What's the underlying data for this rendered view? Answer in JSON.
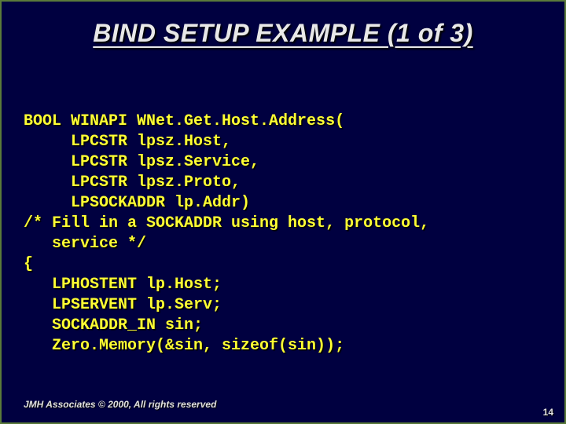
{
  "slide": {
    "title": "BIND SETUP EXAMPLE (1 of 3)",
    "footer": "JMH Associates © 2000, All rights reserved",
    "page_number": "14",
    "code": "BOOL WINAPI WNet.Get.Host.Address(\n     LPCSTR lpsz.Host,\n     LPCSTR lpsz.Service,\n     LPCSTR lpsz.Proto,\n     LPSOCKADDR lp.Addr)\n/* Fill in a SOCKADDR using host, protocol,\n   service */\n{\n   LPHOSTENT lp.Host;\n   LPSERVENT lp.Serv;\n   SOCKADDR_IN sin;\n   Zero.Memory(&sin, sizeof(sin));"
  }
}
